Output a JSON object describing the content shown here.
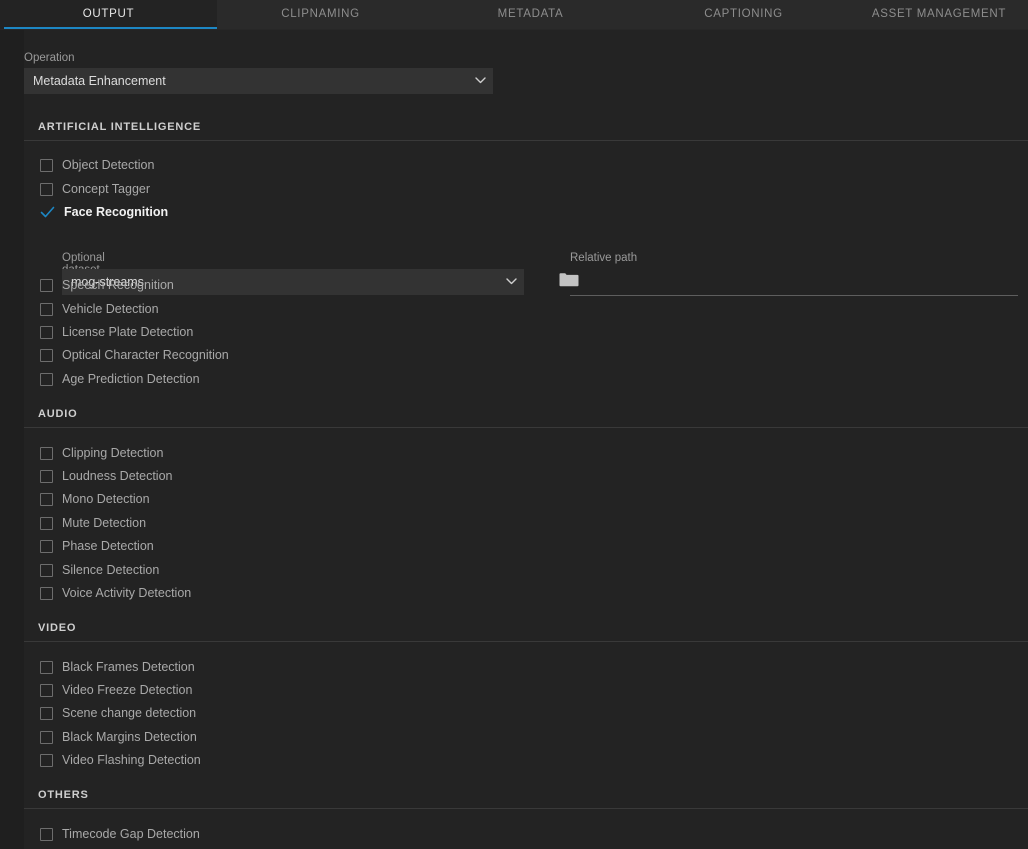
{
  "tabs": [
    {
      "label": "OUTPUT",
      "active": true
    },
    {
      "label": "CLIPNAMING",
      "active": false
    },
    {
      "label": "METADATA",
      "active": false
    },
    {
      "label": "CAPTIONING",
      "active": false
    },
    {
      "label": "ASSET MANAGEMENT",
      "active": false
    }
  ],
  "colors": {
    "accent": "#1d87c4",
    "panel_bg": "#232323",
    "tabbar_bg": "#2a2a2a",
    "select_bg": "#333333",
    "divider": "#393939",
    "label_text": "#9a9a9a",
    "value_text": "#dcdcdc",
    "checkbox_border": "#6d6d6d"
  },
  "operation": {
    "label": "Operation",
    "value": "Metadata Enhancement",
    "options": [
      "Metadata Enhancement"
    ]
  },
  "sections": [
    {
      "title": "ARTIFICIAL INTELLIGENCE",
      "items": [
        {
          "label": "Object Detection",
          "checked": false
        },
        {
          "label": "Concept Tagger",
          "checked": false
        },
        {
          "label": "Face Recognition",
          "checked": true
        },
        {
          "label": "Speech Recognition",
          "checked": false
        },
        {
          "label": "Vehicle Detection",
          "checked": false
        },
        {
          "label": "License Plate Detection",
          "checked": false
        },
        {
          "label": "Optical Character Recognition",
          "checked": false
        },
        {
          "label": "Age Prediction Detection",
          "checked": false
        }
      ]
    },
    {
      "title": "AUDIO",
      "items": [
        {
          "label": "Clipping Detection",
          "checked": false
        },
        {
          "label": "Loudness Detection",
          "checked": false
        },
        {
          "label": "Mono Detection",
          "checked": false
        },
        {
          "label": "Mute Detection",
          "checked": false
        },
        {
          "label": "Phase Detection",
          "checked": false
        },
        {
          "label": "Silence Detection",
          "checked": false
        },
        {
          "label": "Voice Activity Detection",
          "checked": false
        }
      ]
    },
    {
      "title": "VIDEO",
      "items": [
        {
          "label": "Black Frames Detection",
          "checked": false
        },
        {
          "label": "Video Freeze Detection",
          "checked": false
        },
        {
          "label": "Scene change detection",
          "checked": false
        },
        {
          "label": "Black Margins Detection",
          "checked": false
        },
        {
          "label": "Video Flashing Detection",
          "checked": false
        }
      ]
    },
    {
      "title": "OTHERS",
      "items": [
        {
          "label": "Timecode Gap Detection",
          "checked": false
        }
      ]
    }
  ],
  "face_recognition_options": {
    "dataset_storage": {
      "label": "Optional dataset storage",
      "value": "mog-streams",
      "options": [
        "mog-streams"
      ]
    },
    "browse_icon": "folder-icon",
    "relative_path": {
      "label": "Relative path",
      "value": "",
      "placeholder": ""
    }
  }
}
